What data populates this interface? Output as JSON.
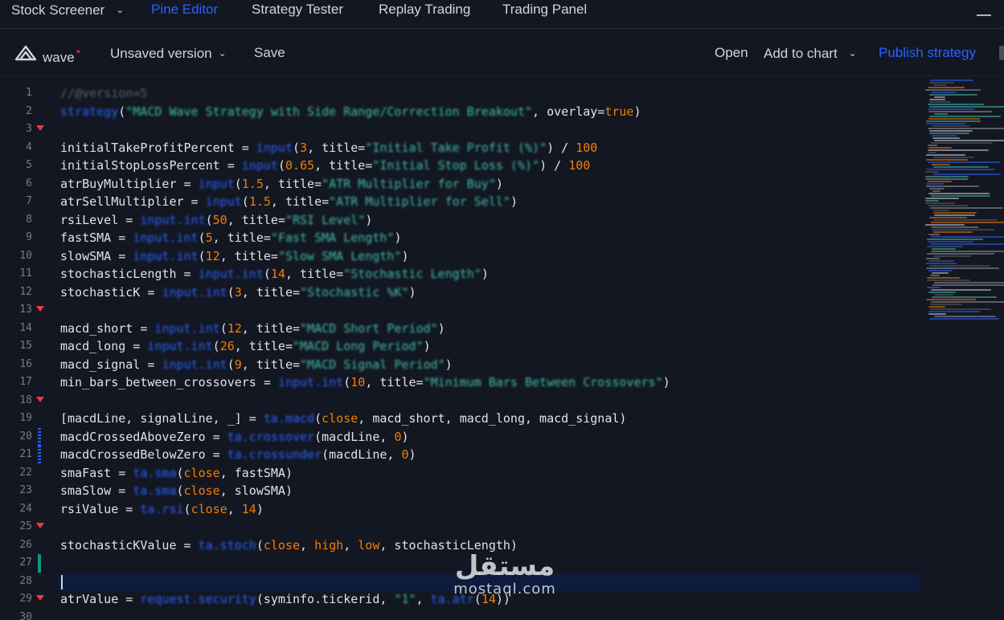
{
  "topnav": {
    "tabs": [
      {
        "label": "Stock Screener",
        "has_dropdown": true
      },
      {
        "label": "Pine Editor",
        "active": true
      },
      {
        "label": "Strategy Tester"
      },
      {
        "label": "Replay Trading"
      },
      {
        "label": "Trading Panel"
      }
    ]
  },
  "toolbar": {
    "script_name": "wave",
    "unsaved_marker": "*",
    "version_label": "Unsaved version",
    "save_label": "Save",
    "open_label": "Open",
    "add_to_chart_label": "Add to chart",
    "publish_label": "Publish strategy"
  },
  "editor": {
    "lines": [
      {
        "n": "1",
        "parts": [
          [
            "cm",
            "//@version=5"
          ]
        ]
      },
      {
        "n": "2",
        "parts": [
          [
            "kw",
            "strategy"
          ],
          [
            "op",
            "("
          ],
          [
            "str",
            "\"MACD Wave Strategy with Side Range/Correction Breakout\""
          ],
          [
            "op",
            ", overlay="
          ],
          [
            "num",
            "true"
          ],
          [
            "op",
            ")"
          ]
        ]
      },
      {
        "n": "3",
        "fold": true,
        "parts": []
      },
      {
        "n": "4",
        "parts": [
          [
            "var",
            "initialTakeProfitPercent = "
          ],
          [
            "fn",
            "input"
          ],
          [
            "op",
            "("
          ],
          [
            "num",
            "3"
          ],
          [
            "op",
            ", title="
          ],
          [
            "str",
            "\"Initial Take Profit (%)\""
          ],
          [
            "op",
            ") / "
          ],
          [
            "num",
            "100"
          ]
        ]
      },
      {
        "n": "5",
        "parts": [
          [
            "var",
            "initialStopLossPercent = "
          ],
          [
            "fn",
            "input"
          ],
          [
            "op",
            "("
          ],
          [
            "num",
            "0.65"
          ],
          [
            "op",
            ", title="
          ],
          [
            "str",
            "\"Initial Stop Loss (%)\""
          ],
          [
            "op",
            ") / "
          ],
          [
            "num",
            "100"
          ]
        ]
      },
      {
        "n": "6",
        "parts": [
          [
            "var",
            "atrBuyMultiplier = "
          ],
          [
            "fn",
            "input"
          ],
          [
            "op",
            "("
          ],
          [
            "num",
            "1.5"
          ],
          [
            "op",
            ", title="
          ],
          [
            "str",
            "\"ATR Multiplier for Buy\""
          ],
          [
            "op",
            ")"
          ]
        ]
      },
      {
        "n": "7",
        "parts": [
          [
            "var",
            "atrSellMultiplier = "
          ],
          [
            "fn",
            "input"
          ],
          [
            "op",
            "("
          ],
          [
            "num",
            "1.5"
          ],
          [
            "op",
            ", title="
          ],
          [
            "str",
            "\"ATR Multiplier for Sell\""
          ],
          [
            "op",
            ")"
          ]
        ]
      },
      {
        "n": "8",
        "parts": [
          [
            "var",
            "rsiLevel = "
          ],
          [
            "fn",
            "input.int"
          ],
          [
            "op",
            "("
          ],
          [
            "num",
            "50"
          ],
          [
            "op",
            ", title="
          ],
          [
            "str",
            "\"RSI Level\""
          ],
          [
            "op",
            ")"
          ]
        ]
      },
      {
        "n": "9",
        "parts": [
          [
            "var",
            "fastSMA = "
          ],
          [
            "fn",
            "input.int"
          ],
          [
            "op",
            "("
          ],
          [
            "num",
            "5"
          ],
          [
            "op",
            ", title="
          ],
          [
            "str",
            "\"Fast SMA Length\""
          ],
          [
            "op",
            ")"
          ]
        ]
      },
      {
        "n": "10",
        "parts": [
          [
            "var",
            "slowSMA = "
          ],
          [
            "fn",
            "input.int"
          ],
          [
            "op",
            "("
          ],
          [
            "num",
            "12"
          ],
          [
            "op",
            ", title="
          ],
          [
            "str",
            "\"Slow SMA Length\""
          ],
          [
            "op",
            ")"
          ]
        ]
      },
      {
        "n": "11",
        "parts": [
          [
            "var",
            "stochasticLength = "
          ],
          [
            "fn",
            "input.int"
          ],
          [
            "op",
            "("
          ],
          [
            "num",
            "14"
          ],
          [
            "op",
            ", title="
          ],
          [
            "str",
            "\"Stochastic Length\""
          ],
          [
            "op",
            ")"
          ]
        ]
      },
      {
        "n": "12",
        "parts": [
          [
            "var",
            "stochasticK = "
          ],
          [
            "fn",
            "input.int"
          ],
          [
            "op",
            "("
          ],
          [
            "num",
            "3"
          ],
          [
            "op",
            ", title="
          ],
          [
            "str",
            "\"Stochastic %K\""
          ],
          [
            "op",
            ")"
          ]
        ]
      },
      {
        "n": "13",
        "fold": true,
        "parts": []
      },
      {
        "n": "14",
        "parts": [
          [
            "var",
            "macd_short = "
          ],
          [
            "fn",
            "input.int"
          ],
          [
            "op",
            "("
          ],
          [
            "num",
            "12"
          ],
          [
            "op",
            ", title="
          ],
          [
            "str",
            "\"MACD Short Period\""
          ],
          [
            "op",
            ")"
          ]
        ]
      },
      {
        "n": "15",
        "parts": [
          [
            "var",
            "macd_long = "
          ],
          [
            "fn",
            "input.int"
          ],
          [
            "op",
            "("
          ],
          [
            "num",
            "26"
          ],
          [
            "op",
            ", title="
          ],
          [
            "str",
            "\"MACD Long Period\""
          ],
          [
            "op",
            ")"
          ]
        ]
      },
      {
        "n": "16",
        "parts": [
          [
            "var",
            "macd_signal = "
          ],
          [
            "fn",
            "input.int"
          ],
          [
            "op",
            "("
          ],
          [
            "num",
            "9"
          ],
          [
            "op",
            ", title="
          ],
          [
            "str",
            "\"MACD Signal Period\""
          ],
          [
            "op",
            ")"
          ]
        ]
      },
      {
        "n": "17",
        "parts": [
          [
            "var",
            "min_bars_between_crossovers = "
          ],
          [
            "fn",
            "input.int"
          ],
          [
            "op",
            "("
          ],
          [
            "num",
            "10"
          ],
          [
            "op",
            ", title="
          ],
          [
            "str",
            "\"Minimum Bars Between Crossovers\""
          ],
          [
            "op",
            ")"
          ]
        ]
      },
      {
        "n": "18",
        "fold": true,
        "parts": []
      },
      {
        "n": "19",
        "parts": [
          [
            "var",
            "[macdLine, signalLine, _] = "
          ],
          [
            "fn",
            "ta.macd"
          ],
          [
            "op",
            "("
          ],
          [
            "num",
            "close"
          ],
          [
            "op",
            ", macd_short, macd_long, macd_signal)"
          ]
        ]
      },
      {
        "n": "20",
        "mod": true,
        "parts": [
          [
            "var",
            "macdCrossedAboveZero = "
          ],
          [
            "fn",
            "ta.crossover"
          ],
          [
            "op",
            "(macdLine, "
          ],
          [
            "num",
            "0"
          ],
          [
            "op",
            ")"
          ]
        ]
      },
      {
        "n": "21",
        "mod": true,
        "parts": [
          [
            "var",
            "macdCrossedBelowZero = "
          ],
          [
            "fn",
            "ta.crossunder"
          ],
          [
            "op",
            "(macdLine, "
          ],
          [
            "num",
            "0"
          ],
          [
            "op",
            ")"
          ]
        ]
      },
      {
        "n": "22",
        "parts": [
          [
            "var",
            "smaFast = "
          ],
          [
            "fn",
            "ta.sma"
          ],
          [
            "op",
            "("
          ],
          [
            "num",
            "close"
          ],
          [
            "op",
            ", fastSMA)"
          ]
        ]
      },
      {
        "n": "23",
        "parts": [
          [
            "var",
            "smaSlow = "
          ],
          [
            "fn",
            "ta.sma"
          ],
          [
            "op",
            "("
          ],
          [
            "num",
            "close"
          ],
          [
            "op",
            ", slowSMA)"
          ]
        ]
      },
      {
        "n": "24",
        "parts": [
          [
            "var",
            "rsiValue = "
          ],
          [
            "fn",
            "ta.rsi"
          ],
          [
            "op",
            "("
          ],
          [
            "num",
            "close"
          ],
          [
            "op",
            ", "
          ],
          [
            "num",
            "14"
          ],
          [
            "op",
            ")"
          ]
        ]
      },
      {
        "n": "25",
        "fold": true,
        "parts": []
      },
      {
        "n": "26",
        "parts": [
          [
            "var",
            "stochasticKValue = "
          ],
          [
            "fn",
            "ta.stoch"
          ],
          [
            "op",
            "("
          ],
          [
            "num",
            "close"
          ],
          [
            "op",
            ", "
          ],
          [
            "num",
            "high"
          ],
          [
            "op",
            ", "
          ],
          [
            "num",
            "low"
          ],
          [
            "op",
            ", stochasticLength)"
          ]
        ]
      },
      {
        "n": "27",
        "added": true,
        "parts": []
      },
      {
        "n": "28",
        "parts": []
      },
      {
        "n": "29",
        "fold": true,
        "parts": [
          [
            "var",
            "atrValue = "
          ],
          [
            "fn",
            "request.security"
          ],
          [
            "op",
            "(syminfo.tickerid, "
          ],
          [
            "str",
            "\"1\""
          ],
          [
            "op",
            ", "
          ],
          [
            "fn",
            "ta.atr"
          ],
          [
            "op",
            "("
          ],
          [
            "num",
            "14"
          ],
          [
            "op",
            "))"
          ]
        ]
      },
      {
        "n": "30",
        "parts": []
      }
    ]
  },
  "watermark": {
    "arabic": "مستقل",
    "latin": "mostaql.com"
  },
  "colors": {
    "background": "#131722",
    "accent": "#2962ff",
    "string": "#42bda8",
    "number": "#f57c00",
    "comment": "#5d606b",
    "fold_marker": "#f23645"
  }
}
